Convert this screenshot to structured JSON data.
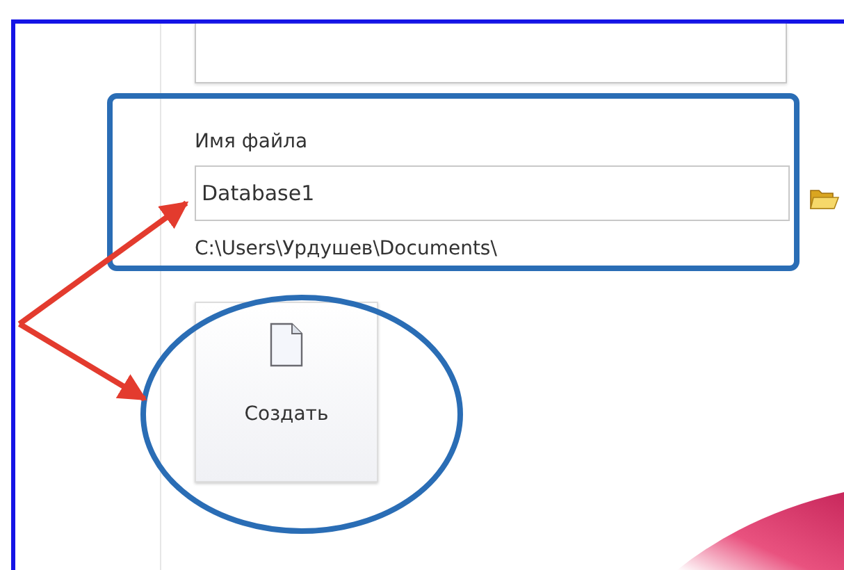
{
  "file_name": {
    "label": "Имя файла",
    "value": "Database1",
    "path": "C:\\Users\\Урдушев\\Documents\\"
  },
  "create_button": {
    "label": "Создать"
  }
}
